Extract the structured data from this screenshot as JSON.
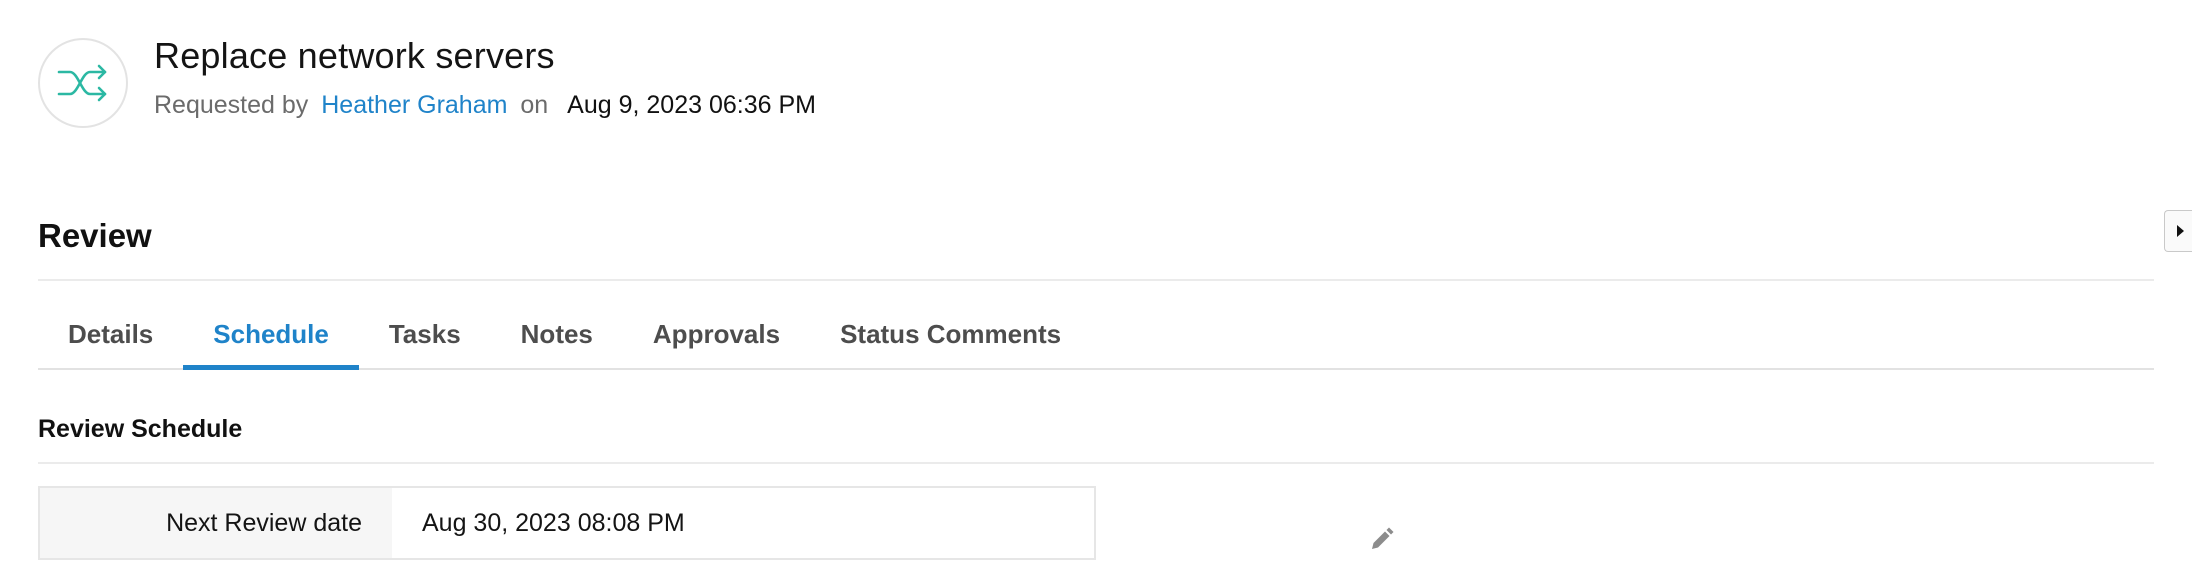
{
  "header": {
    "icon": "shuffle-icon",
    "title": "Replace network servers",
    "requested_by_label": "Requested by",
    "requester": "Heather Graham",
    "on_label": "on",
    "requested_date": "Aug 9, 2023 06:36 PM"
  },
  "review": {
    "heading": "Review",
    "tabs": [
      {
        "label": "Details",
        "active": false
      },
      {
        "label": "Schedule",
        "active": true
      },
      {
        "label": "Tasks",
        "active": false
      },
      {
        "label": "Notes",
        "active": false
      },
      {
        "label": "Approvals",
        "active": false
      },
      {
        "label": "Status Comments",
        "active": false
      }
    ]
  },
  "schedule": {
    "heading": "Review Schedule",
    "field_label": "Next Review date",
    "field_value": "Aug 30, 2023 08:08 PM",
    "edit_icon": "pencil-icon"
  },
  "side_panel": {
    "toggle_icon": "caret-right-icon"
  },
  "colors": {
    "accent": "#1f83c9",
    "icon_teal": "#2bb8a3",
    "tab_text": "#4d4d4d"
  }
}
